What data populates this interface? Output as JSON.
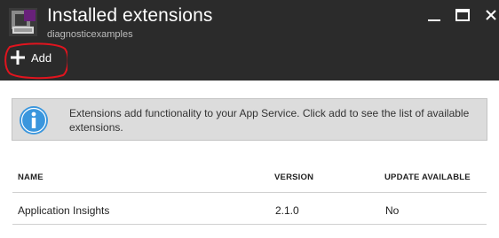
{
  "header": {
    "title": "Installed extensions",
    "subtitle": "diagnosticexamples",
    "blade_icon": "extensions-icon",
    "window_controls": [
      "minimize-icon",
      "maximize-icon",
      "close-icon"
    ]
  },
  "toolbar": {
    "add_label": "Add",
    "add_icon": "plus-icon"
  },
  "info": {
    "icon": "info-icon",
    "text": "Extensions add functionality to your App Service. Click add to see the list of available extensions."
  },
  "table": {
    "columns": [
      "NAME",
      "VERSION",
      "UPDATE AVAILABLE"
    ],
    "rows": [
      {
        "name": "Application Insights",
        "version": "2.1.0",
        "update": "No"
      }
    ]
  },
  "colors": {
    "header_bg": "#2b2b2b",
    "info_bg": "#dcdcdc",
    "info_icon": "#3a96dd",
    "annotation": "#e0141e"
  }
}
